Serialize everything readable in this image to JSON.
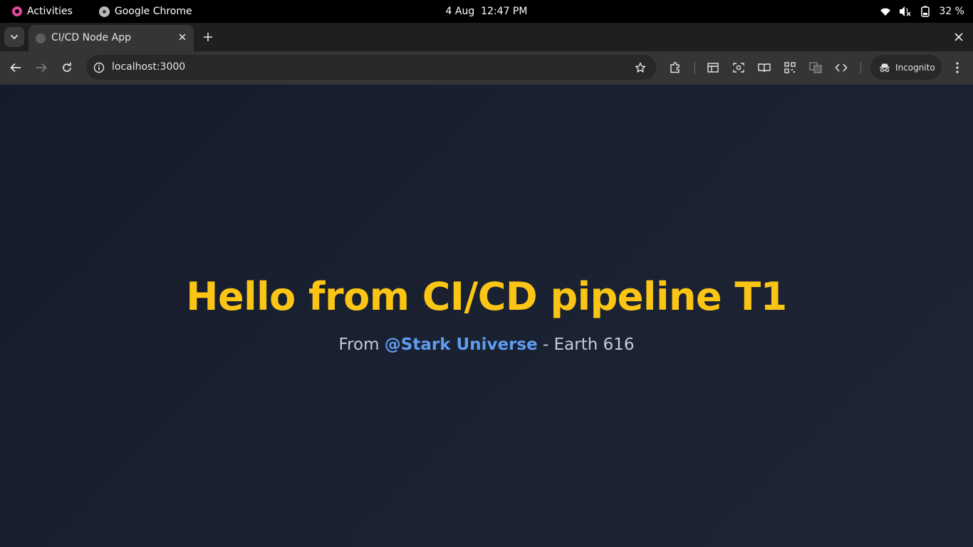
{
  "topbar": {
    "activities_label": "Activities",
    "app_name": "Google Chrome",
    "date": "4 Aug",
    "time": "12:47 PM",
    "battery": "32 %"
  },
  "tabs": [
    {
      "title": "CI/CD Node App"
    }
  ],
  "toolbar": {
    "url": "localhost:3000",
    "incognito_label": "Incognito"
  },
  "page": {
    "heading": "Hello from CI/CD pipeline T1",
    "sub_prefix": "From",
    "sub_link": "@Stark Universe",
    "sub_suffix": "- Earth 616"
  },
  "colors": {
    "heading": "#fac515",
    "link": "#5f9cf0",
    "page_bg": "#1a2131"
  }
}
